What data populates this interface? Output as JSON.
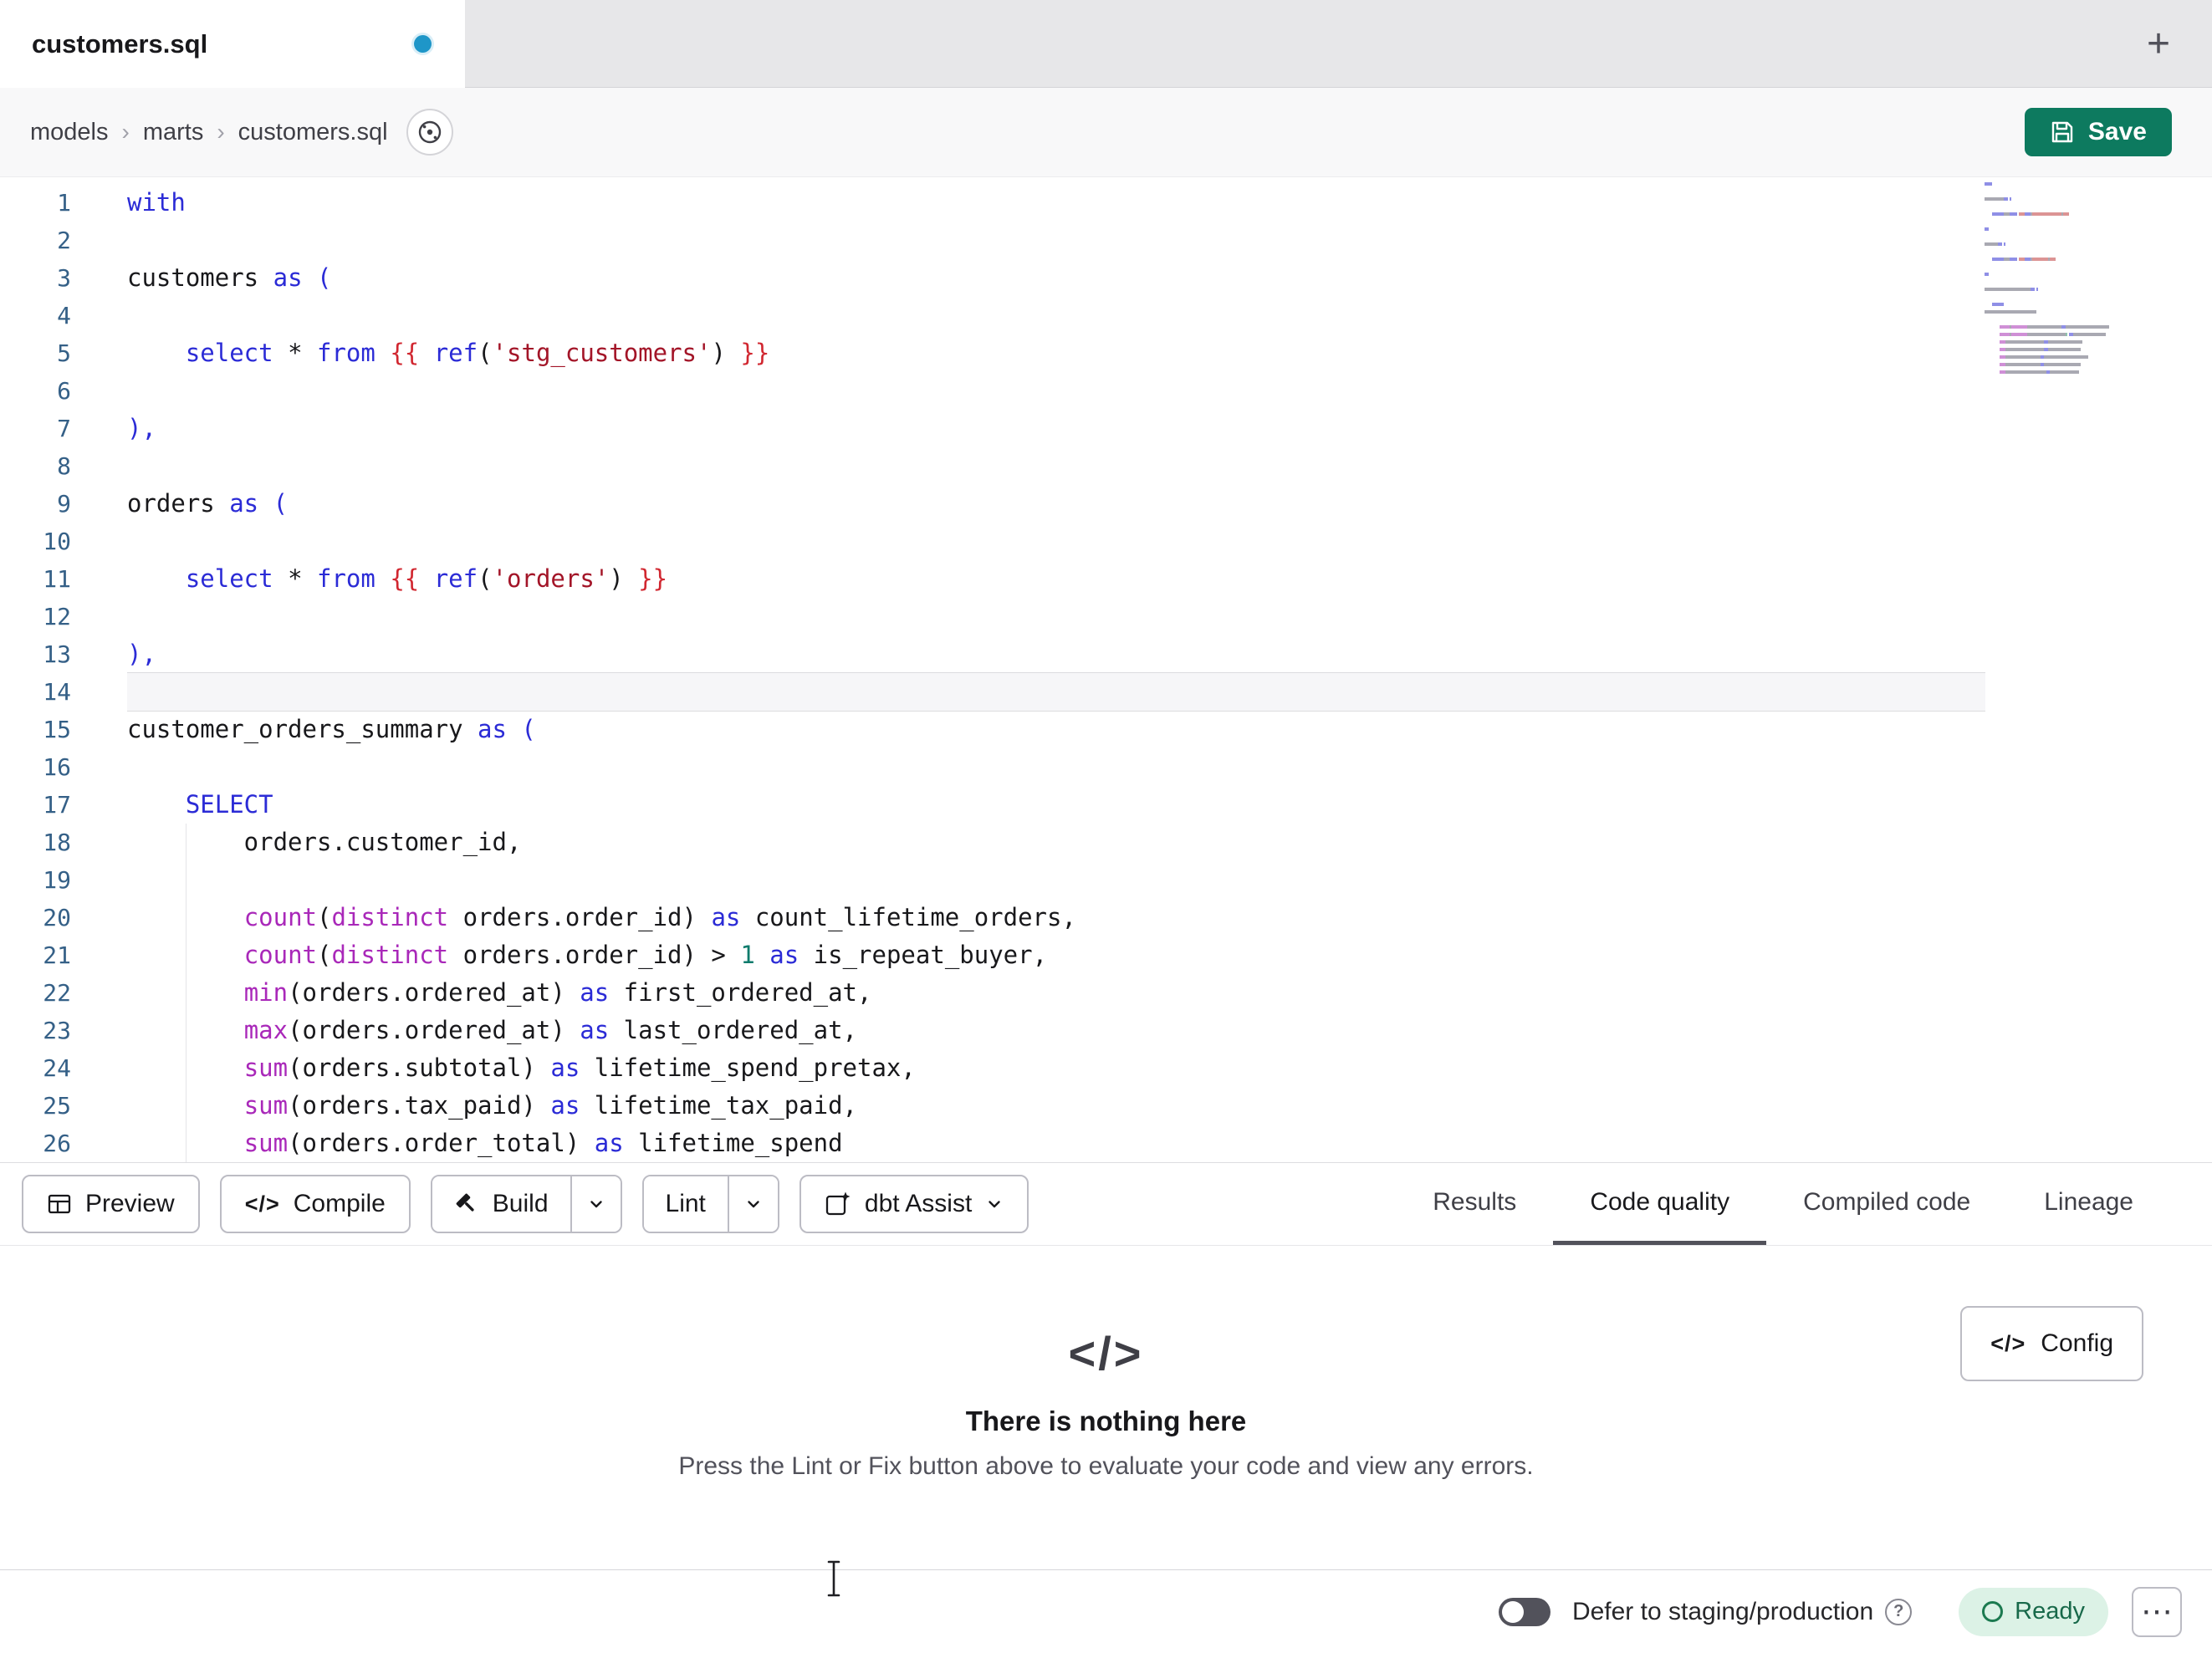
{
  "tabbar": {
    "active_tab": "customers.sql",
    "new_tab": "+"
  },
  "breadcrumb": {
    "items": [
      "models",
      "marts",
      "customers.sql"
    ],
    "separator": "›"
  },
  "save_button": {
    "label": "Save"
  },
  "editor": {
    "active_line": 14,
    "lines": [
      {
        "n": 1,
        "s": [
          [
            "kw",
            "with"
          ]
        ]
      },
      {
        "n": 2,
        "s": []
      },
      {
        "n": 3,
        "s": [
          [
            "pl",
            "customers "
          ],
          [
            "kw",
            "as"
          ],
          [
            "pl",
            " "
          ],
          [
            "pun",
            "("
          ]
        ]
      },
      {
        "n": 4,
        "s": []
      },
      {
        "n": 5,
        "s": [
          [
            "pl",
            "    "
          ],
          [
            "kw",
            "select"
          ],
          [
            "pl",
            " * "
          ],
          [
            "kw",
            "from"
          ],
          [
            "pl",
            " "
          ],
          [
            "jinja",
            "{{ "
          ],
          [
            "kw",
            "ref"
          ],
          [
            "pl",
            "("
          ],
          [
            "str",
            "'stg_customers'"
          ],
          [
            "pl",
            ")"
          ],
          [
            "jinja",
            " }}"
          ]
        ]
      },
      {
        "n": 6,
        "s": []
      },
      {
        "n": 7,
        "s": [
          [
            "pun",
            "),"
          ]
        ]
      },
      {
        "n": 8,
        "s": []
      },
      {
        "n": 9,
        "s": [
          [
            "pl",
            "orders "
          ],
          [
            "kw",
            "as"
          ],
          [
            "pl",
            " "
          ],
          [
            "pun",
            "("
          ]
        ]
      },
      {
        "n": 10,
        "s": []
      },
      {
        "n": 11,
        "s": [
          [
            "pl",
            "    "
          ],
          [
            "kw",
            "select"
          ],
          [
            "pl",
            " * "
          ],
          [
            "kw",
            "from"
          ],
          [
            "pl",
            " "
          ],
          [
            "jinja",
            "{{ "
          ],
          [
            "kw",
            "ref"
          ],
          [
            "pl",
            "("
          ],
          [
            "str",
            "'orders'"
          ],
          [
            "pl",
            ")"
          ],
          [
            "jinja",
            " }}"
          ]
        ]
      },
      {
        "n": 12,
        "s": []
      },
      {
        "n": 13,
        "s": [
          [
            "pun",
            "),"
          ]
        ]
      },
      {
        "n": 14,
        "s": []
      },
      {
        "n": 15,
        "s": [
          [
            "pl",
            "customer_orders_summary "
          ],
          [
            "kw",
            "as"
          ],
          [
            "pl",
            " "
          ],
          [
            "pun",
            "("
          ]
        ]
      },
      {
        "n": 16,
        "s": []
      },
      {
        "n": 17,
        "s": [
          [
            "pl",
            "    "
          ],
          [
            "kw",
            "SELECT"
          ]
        ]
      },
      {
        "n": 18,
        "g": 1,
        "s": [
          [
            "pl",
            "        orders.customer_id,"
          ]
        ]
      },
      {
        "n": 19,
        "g": 1,
        "s": []
      },
      {
        "n": 20,
        "g": 1,
        "s": [
          [
            "pl",
            "        "
          ],
          [
            "fn",
            "count"
          ],
          [
            "pl",
            "("
          ],
          [
            "fn",
            "distinct"
          ],
          [
            "pl",
            " orders.order_id) "
          ],
          [
            "kw",
            "as"
          ],
          [
            "pl",
            " count_lifetime_orders,"
          ]
        ]
      },
      {
        "n": 21,
        "g": 1,
        "s": [
          [
            "pl",
            "        "
          ],
          [
            "fn",
            "count"
          ],
          [
            "pl",
            "("
          ],
          [
            "fn",
            "distinct"
          ],
          [
            "pl",
            " orders.order_id) > "
          ],
          [
            "num",
            "1"
          ],
          [
            "pl",
            " "
          ],
          [
            "kw",
            "as"
          ],
          [
            "pl",
            " is_repeat_buyer,"
          ]
        ]
      },
      {
        "n": 22,
        "g": 1,
        "s": [
          [
            "pl",
            "        "
          ],
          [
            "fn",
            "min"
          ],
          [
            "pl",
            "(orders.ordered_at) "
          ],
          [
            "kw",
            "as"
          ],
          [
            "pl",
            " first_ordered_at,"
          ]
        ]
      },
      {
        "n": 23,
        "g": 1,
        "s": [
          [
            "pl",
            "        "
          ],
          [
            "fn",
            "max"
          ],
          [
            "pl",
            "(orders.ordered_at) "
          ],
          [
            "kw",
            "as"
          ],
          [
            "pl",
            " last_ordered_at,"
          ]
        ]
      },
      {
        "n": 24,
        "g": 1,
        "s": [
          [
            "pl",
            "        "
          ],
          [
            "fn",
            "sum"
          ],
          [
            "pl",
            "(orders.subtotal) "
          ],
          [
            "kw",
            "as"
          ],
          [
            "pl",
            " lifetime_spend_pretax,"
          ]
        ]
      },
      {
        "n": 25,
        "g": 1,
        "s": [
          [
            "pl",
            "        "
          ],
          [
            "fn",
            "sum"
          ],
          [
            "pl",
            "(orders.tax_paid) "
          ],
          [
            "kw",
            "as"
          ],
          [
            "pl",
            " lifetime_tax_paid,"
          ]
        ]
      },
      {
        "n": 26,
        "g": 1,
        "s": [
          [
            "pl",
            "        "
          ],
          [
            "fn",
            "sum"
          ],
          [
            "pl",
            "(orders.order_total) "
          ],
          [
            "kw",
            "as"
          ],
          [
            "pl",
            " lifetime_spend"
          ]
        ]
      }
    ]
  },
  "toolbar": {
    "preview": "Preview",
    "compile": "Compile",
    "compile_icon": "</>",
    "build": "Build",
    "lint": "Lint",
    "assist": "dbt Assist"
  },
  "result_tabs": [
    {
      "label": "Results",
      "active": false
    },
    {
      "label": "Code quality",
      "active": true
    },
    {
      "label": "Compiled code",
      "active": false
    },
    {
      "label": "Lineage",
      "active": false
    }
  ],
  "panel": {
    "icon": "</>",
    "title": "There is nothing here",
    "subtitle": "Press the Lint or Fix button above to evaluate your code and view any errors.",
    "config_icon": "</>",
    "config_label": "Config"
  },
  "statusbar": {
    "defer_label": "Defer to staging/production",
    "help": "?",
    "ready": "Ready",
    "menu": "⋯"
  },
  "colors": {
    "save_green": "#0d7a5f",
    "tab_dot_blue": "#1e96c8",
    "keyword_blue": "#2b2bd6",
    "function_purple": "#a928b9",
    "string_red": "#a31528",
    "jinja_red": "#d12730",
    "number_teal": "#0f7b6c",
    "line_number_blue": "#356087",
    "ready_bg": "#dcf2e6",
    "ready_text": "#18694a"
  }
}
